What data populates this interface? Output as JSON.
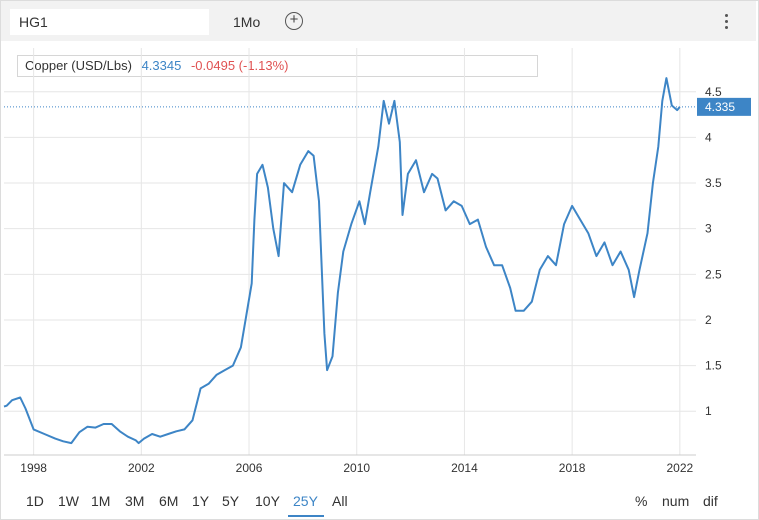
{
  "toolbar": {
    "symbol": "HG1",
    "interval": "1Mo",
    "add_icon": "plus-circle-icon",
    "menu_icon": "vertical-dots-icon"
  },
  "legend": {
    "name": "Copper (USD/Lbs)",
    "value": "4.3345",
    "change": "-0.0495 (-1.13%)"
  },
  "price_tag": "4.335",
  "colors": {
    "line": "#3d85c6",
    "grid": "#e6e6e6",
    "positive": "#3d85c6",
    "negative": "#e05252"
  },
  "ranges": [
    {
      "label": "1D",
      "active": false
    },
    {
      "label": "1W",
      "active": false
    },
    {
      "label": "1M",
      "active": false
    },
    {
      "label": "3M",
      "active": false
    },
    {
      "label": "6M",
      "active": false
    },
    {
      "label": "1Y",
      "active": false
    },
    {
      "label": "5Y",
      "active": false
    },
    {
      "label": "10Y",
      "active": false
    },
    {
      "label": "25Y",
      "active": true
    },
    {
      "label": "All",
      "active": false
    }
  ],
  "options": [
    "%",
    "num",
    "dif"
  ],
  "chart_data": {
    "type": "line",
    "xlabel": "",
    "ylabel": "",
    "x_ticks": [
      "1998",
      "2002",
      "2006",
      "2010",
      "2014",
      "2018",
      "2022"
    ],
    "y_ticks": [
      "1",
      "1.5",
      "2",
      "2.5",
      "3",
      "3.5",
      "4",
      "4.5"
    ],
    "xlim": [
      1996.9,
      2022.6
    ],
    "ylim": [
      0.52,
      4.98
    ],
    "grid": true,
    "current_price_line": 4.335,
    "series": [
      {
        "x": [
          1996.9,
          1997.0,
          1997.2,
          1997.5,
          1997.7,
          1998.0,
          1998.4,
          1998.8,
          1999.1,
          1999.4,
          1999.7,
          2000.0,
          2000.3,
          2000.6,
          2000.9,
          2001.2,
          2001.5,
          2001.8,
          2001.9,
          2002.1,
          2002.4,
          2002.7,
          2003.0,
          2003.3,
          2003.6,
          2003.9,
          2004.2,
          2004.5,
          2004.8,
          2005.1,
          2005.4,
          2005.7,
          2005.9,
          2006.1,
          2006.2,
          2006.3,
          2006.5,
          2006.7,
          2006.9,
          2007.1,
          2007.3,
          2007.6,
          2007.9,
          2008.2,
          2008.4,
          2008.6,
          2008.8,
          2008.9,
          2009.1,
          2009.3,
          2009.5,
          2009.8,
          2010.1,
          2010.3,
          2010.5,
          2010.8,
          2011.0,
          2011.2,
          2011.4,
          2011.6,
          2011.7,
          2011.9,
          2012.2,
          2012.5,
          2012.8,
          2013.0,
          2013.3,
          2013.6,
          2013.9,
          2014.2,
          2014.5,
          2014.8,
          2015.1,
          2015.4,
          2015.7,
          2015.9,
          2016.2,
          2016.5,
          2016.8,
          2017.1,
          2017.4,
          2017.7,
          2018.0,
          2018.3,
          2018.6,
          2018.9,
          2019.2,
          2019.5,
          2019.8,
          2020.1,
          2020.3,
          2020.5,
          2020.8,
          2021.0,
          2021.2,
          2021.35,
          2021.5,
          2021.7,
          2021.9,
          2022.0
        ],
        "y": [
          1.05,
          1.06,
          1.12,
          1.15,
          1.03,
          0.8,
          0.75,
          0.7,
          0.67,
          0.65,
          0.77,
          0.83,
          0.82,
          0.86,
          0.86,
          0.78,
          0.72,
          0.68,
          0.65,
          0.7,
          0.75,
          0.72,
          0.75,
          0.78,
          0.8,
          0.9,
          1.25,
          1.3,
          1.4,
          1.45,
          1.5,
          1.7,
          2.05,
          2.4,
          3.1,
          3.6,
          3.7,
          3.45,
          3.0,
          2.7,
          3.5,
          3.4,
          3.7,
          3.85,
          3.8,
          3.3,
          1.85,
          1.45,
          1.6,
          2.3,
          2.75,
          3.05,
          3.3,
          3.05,
          3.4,
          3.9,
          4.4,
          4.15,
          4.4,
          3.95,
          3.15,
          3.6,
          3.75,
          3.4,
          3.6,
          3.55,
          3.2,
          3.3,
          3.25,
          3.05,
          3.1,
          2.8,
          2.6,
          2.6,
          2.35,
          2.1,
          2.1,
          2.2,
          2.55,
          2.7,
          2.6,
          3.05,
          3.25,
          3.1,
          2.95,
          2.7,
          2.85,
          2.6,
          2.75,
          2.55,
          2.25,
          2.55,
          2.95,
          3.5,
          3.9,
          4.4,
          4.65,
          4.35,
          4.3,
          4.335
        ]
      }
    ]
  }
}
